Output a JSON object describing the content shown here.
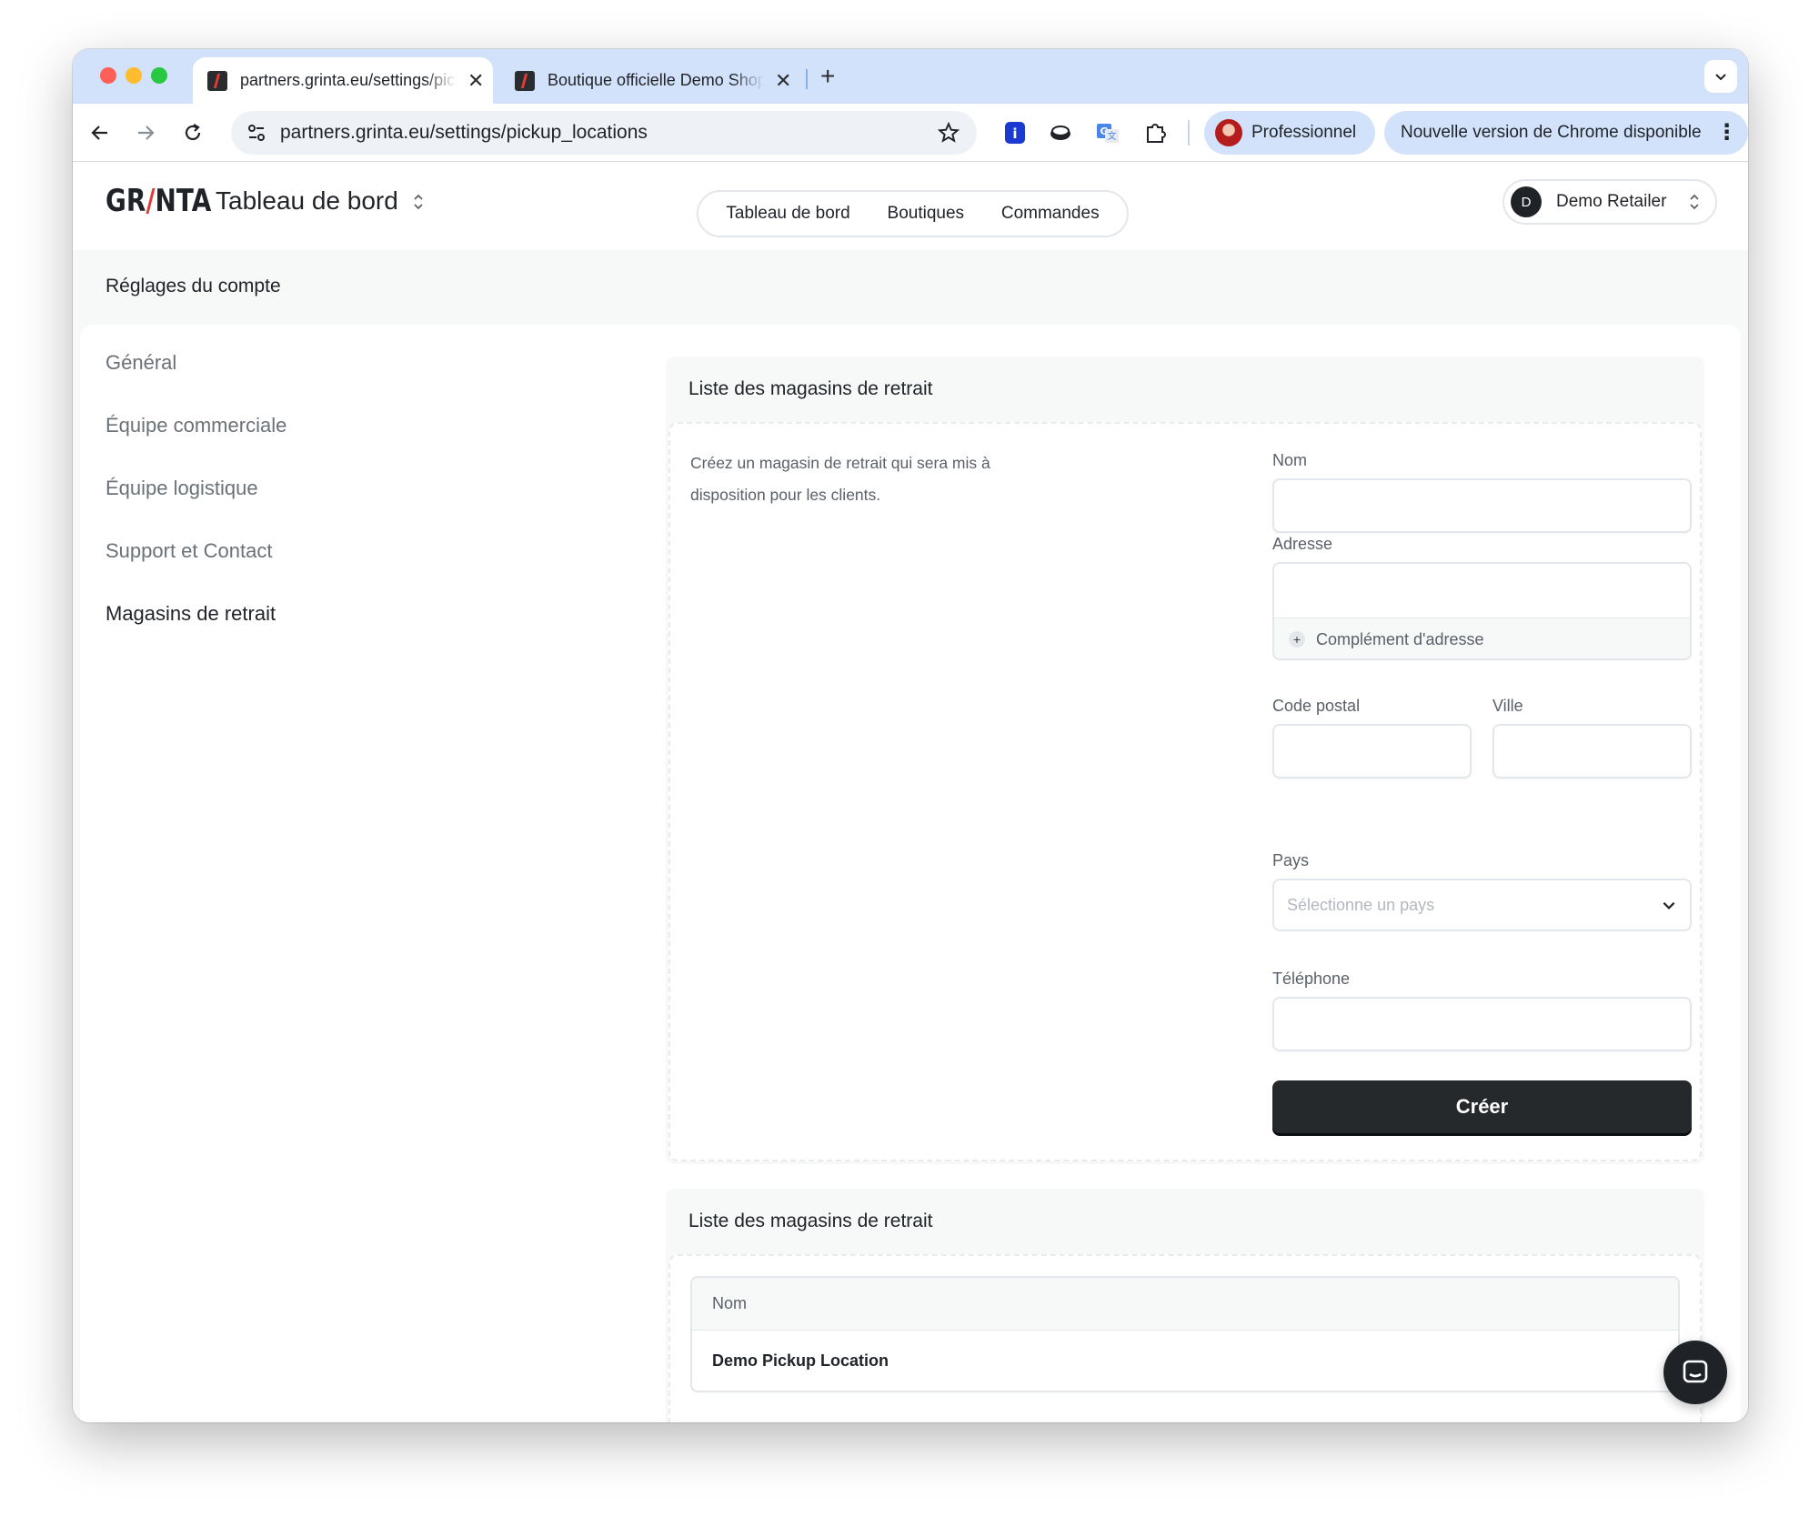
{
  "browser": {
    "tabs": [
      {
        "title": "partners.grinta.eu/settings/pickup_locations",
        "active": true
      },
      {
        "title": "Boutique officielle Demo Shop",
        "active": false
      }
    ],
    "url": "partners.grinta.eu/settings/pickup_locations",
    "profile_label": "Professionnel",
    "update_label": "Nouvelle version de Chrome disponible"
  },
  "header": {
    "logo_left": "GR",
    "logo_slash": "/",
    "logo_right": "NTA",
    "title": "Tableau de bord",
    "nav": [
      "Tableau de bord",
      "Boutiques",
      "Commandes"
    ],
    "account_initial": "D",
    "account_name": "Demo Retailer"
  },
  "settings": {
    "title": "Réglages du compte",
    "menu": [
      {
        "label": "Général",
        "active": false
      },
      {
        "label": "Équipe commerciale",
        "active": false
      },
      {
        "label": "Équipe logistique",
        "active": false
      },
      {
        "label": "Support et Contact",
        "active": false
      },
      {
        "label": "Magasins de retrait",
        "active": true
      }
    ]
  },
  "create_card": {
    "title": "Liste des magasins de retrait",
    "description": "Créez un magasin de retrait qui sera mis à disposition pour les clients.",
    "fields": {
      "name_label": "Nom",
      "address_label": "Adresse",
      "address_extra": "Complément d'adresse",
      "postal_label": "Code postal",
      "city_label": "Ville",
      "country_label": "Pays",
      "country_placeholder": "Sélectionne un pays",
      "phone_label": "Téléphone"
    },
    "submit_label": "Créer"
  },
  "list_card": {
    "title": "Liste des magasins de retrait",
    "columns": [
      "Nom"
    ],
    "rows": [
      [
        "Demo Pickup Location"
      ]
    ]
  },
  "colors": {
    "accent": "#e53935",
    "primary_button": "#26292c",
    "tab_strip": "#d3e2fb"
  }
}
